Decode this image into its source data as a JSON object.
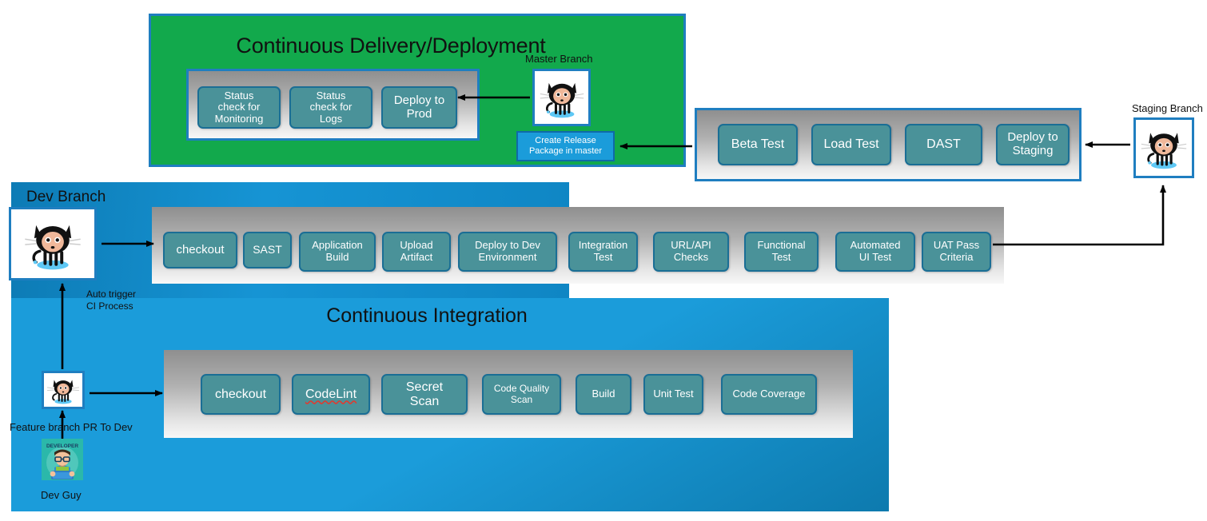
{
  "cd_section": {
    "title": "Continuous Delivery/Deployment",
    "stages": [
      {
        "label": "Status\ncheck for\nMonitoring"
      },
      {
        "label": "Status\ncheck for\nLogs"
      },
      {
        "label": "Deploy to\nProd"
      }
    ],
    "master_branch_label": "Master Branch",
    "release_box_label": "Create Release\nPackage in master"
  },
  "staging_section": {
    "stages": [
      {
        "label": "Beta Test"
      },
      {
        "label": "Load Test"
      },
      {
        "label": "DAST"
      },
      {
        "label": "Deploy to\nStaging"
      }
    ],
    "staging_branch_label": "Staging Branch"
  },
  "dev_section": {
    "panel_title": "Dev Branch",
    "stages": [
      {
        "label": "checkout"
      },
      {
        "label": "SAST"
      },
      {
        "label": "Application\nBuild"
      },
      {
        "label": "Upload\nArtifact"
      },
      {
        "label": "Deploy to Dev\nEnvironment"
      },
      {
        "label": "Integration\nTest"
      },
      {
        "label": "URL/API\nChecks"
      },
      {
        "label": "Functional\nTest"
      },
      {
        "label": "Automated\nUI Test"
      },
      {
        "label": "UAT Pass\nCriteria"
      }
    ]
  },
  "ci_section": {
    "title": "Continuous Integration",
    "stages": [
      {
        "label": "checkout"
      },
      {
        "label": "CodeLint"
      },
      {
        "label": "Secret\nScan"
      },
      {
        "label": "Code Quality\nScan"
      },
      {
        "label": "Build"
      },
      {
        "label": "Unit Test"
      },
      {
        "label": "Code Coverage"
      }
    ]
  },
  "annotations": {
    "auto_trigger": "Auto trigger\nCI Process",
    "feature_branch_pr": "Feature branch PR To Dev",
    "dev_guy": "Dev Guy",
    "developer_badge": "DEVELOPER"
  },
  "colors": {
    "cd_green": "#12a94c",
    "panel_blue": "#1b9cda",
    "stage_teal": "#4a9299",
    "stage_border": "#1a6e95",
    "frame_blue": "#1f7ec0",
    "arrow_black": "#000000"
  }
}
